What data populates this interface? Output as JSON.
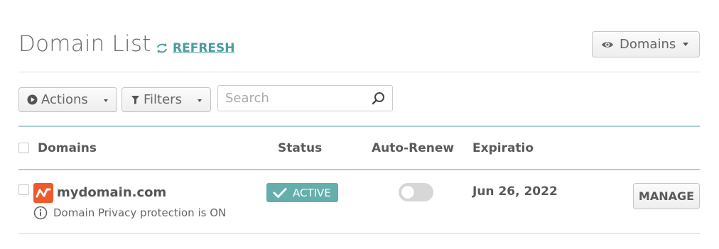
{
  "header": {
    "title": "Domain List",
    "refresh_label": "REFRESH",
    "view_selector_label": "Domains"
  },
  "toolbar": {
    "actions_label": "Actions",
    "filters_label": "Filters",
    "search_placeholder": "Search",
    "search_value": ""
  },
  "table": {
    "columns": [
      "Domains",
      "Status",
      "Auto-Renew",
      "Expiratio"
    ],
    "rows": [
      {
        "domain": "mydomain.com",
        "privacy_note": "Domain Privacy protection is ON",
        "status": "ACTIVE",
        "auto_renew": false,
        "expiration": "Jun 26, 2022",
        "action_label": "MANAGE"
      }
    ]
  },
  "icons": {
    "refresh": "refresh-icon",
    "view": "eye-icon",
    "actions": "play-circle-icon",
    "filters": "filter-icon",
    "search": "search-icon",
    "status": "checkmark-icon",
    "privacy": "info-icon",
    "logo": "namecheap-logo-icon"
  },
  "colors": {
    "accent": "#4a9d9c",
    "status_active": "#64aeab",
    "logo_orange": "#ee5a2c",
    "divider_teal": "#a9d1cf",
    "toggle_off": "#d7d7d7"
  }
}
